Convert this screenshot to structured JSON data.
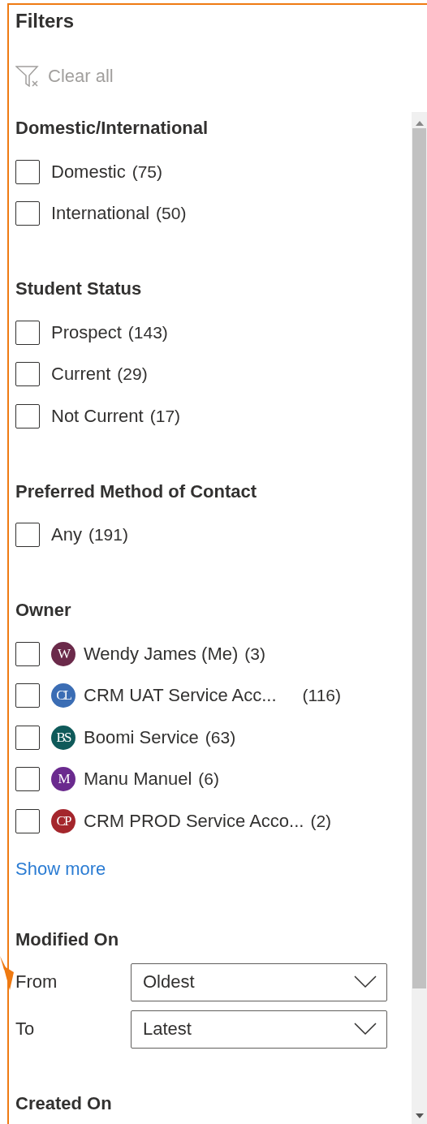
{
  "title": "Filters",
  "clear_all": {
    "label": "Clear all",
    "disabled": true
  },
  "sections": [
    {
      "kind": "checklist",
      "heading": "Domestic/International",
      "items": [
        {
          "label": "Domestic",
          "count": "(75)",
          "checked": false
        },
        {
          "label": "International",
          "count": "(50)",
          "checked": false
        }
      ]
    },
    {
      "kind": "checklist",
      "heading": "Student Status",
      "items": [
        {
          "label": "Prospect",
          "count": "(143)",
          "checked": false
        },
        {
          "label": "Current",
          "count": "(29)",
          "checked": false
        },
        {
          "label": "Not Current",
          "count": "(17)",
          "checked": false
        }
      ]
    },
    {
      "kind": "checklist",
      "heading": "Preferred Method of Contact",
      "items": [
        {
          "label": "Any",
          "count": "(191)",
          "checked": false
        }
      ]
    },
    {
      "kind": "checklist",
      "heading": "Owner",
      "items": [
        {
          "label": "Wendy James (Me)",
          "count": "(3)",
          "checked": false,
          "initials": "W",
          "color": "#6b2a4a"
        },
        {
          "label": "CRM UAT Service Acc...",
          "count": "(116)",
          "checked": false,
          "initials": "CL",
          "color": "#3b6db4"
        },
        {
          "label": "Boomi Service",
          "count": "(63)",
          "checked": false,
          "initials": "BS",
          "color": "#0f5a5a"
        },
        {
          "label": "Manu Manuel",
          "count": "(6)",
          "checked": false,
          "initials": "M",
          "color": "#6a2a8e"
        },
        {
          "label": "CRM PROD Service Acco...",
          "count": "(2)",
          "checked": false,
          "initials": "CP",
          "color": "#a4262c"
        }
      ],
      "show_more": "Show more"
    },
    {
      "kind": "date_range",
      "heading": "Modified On",
      "fields": [
        {
          "label": "From",
          "value": "Oldest"
        },
        {
          "label": "To",
          "value": "Latest"
        }
      ]
    },
    {
      "kind": "date_range",
      "heading": "Created On"
    }
  ]
}
